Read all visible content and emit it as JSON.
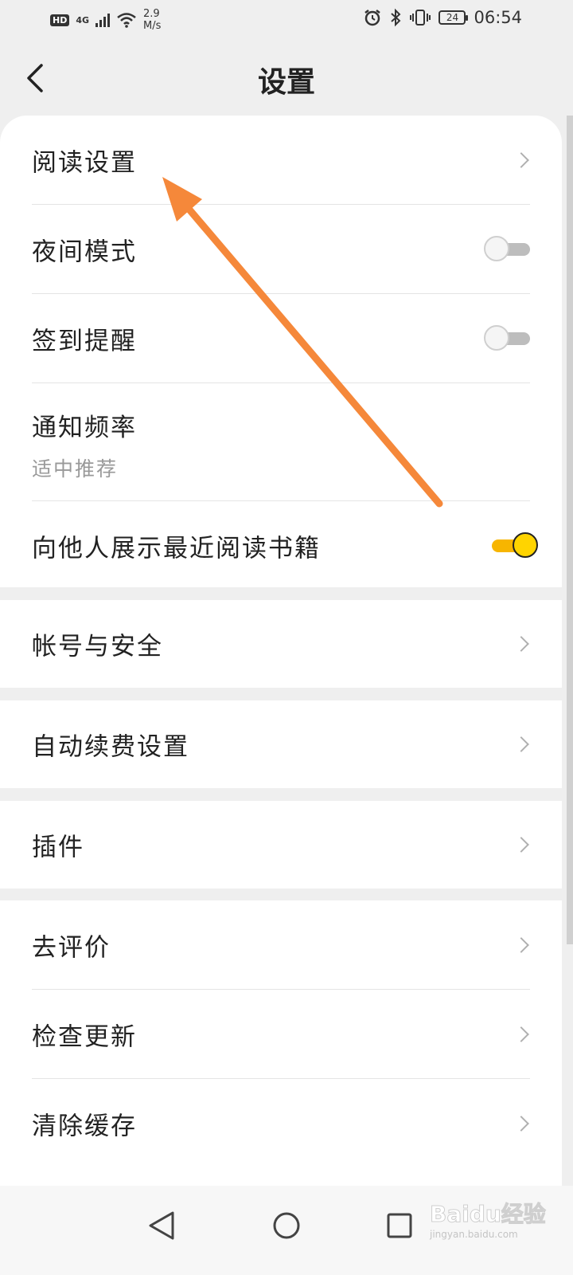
{
  "status_bar": {
    "hd": "HD",
    "network": "4G",
    "speed_value": "2.9",
    "speed_unit": "M/s",
    "battery": "24",
    "time": "06:54"
  },
  "header": {
    "title": "设置"
  },
  "sections": {
    "main": {
      "reading_settings": "阅读设置",
      "night_mode": "夜间模式",
      "night_mode_on": false,
      "checkin_reminder": "签到提醒",
      "checkin_reminder_on": false,
      "notify_frequency": "通知频率",
      "notify_frequency_value": "适中推荐",
      "show_recent_books": "向他人展示最近阅读书籍",
      "show_recent_books_on": true
    },
    "account_security": "帐号与安全",
    "auto_renew": "自动续费设置",
    "plugins": "插件",
    "more": {
      "rate": "去评价",
      "check_update": "检查更新",
      "clear_cache": "清除缓存"
    }
  },
  "colors": {
    "accent": "#ffd400",
    "annotation_arrow": "#f5883a"
  },
  "watermark": {
    "logo": "Baidu经验",
    "url": "jingyan.baidu.com"
  }
}
